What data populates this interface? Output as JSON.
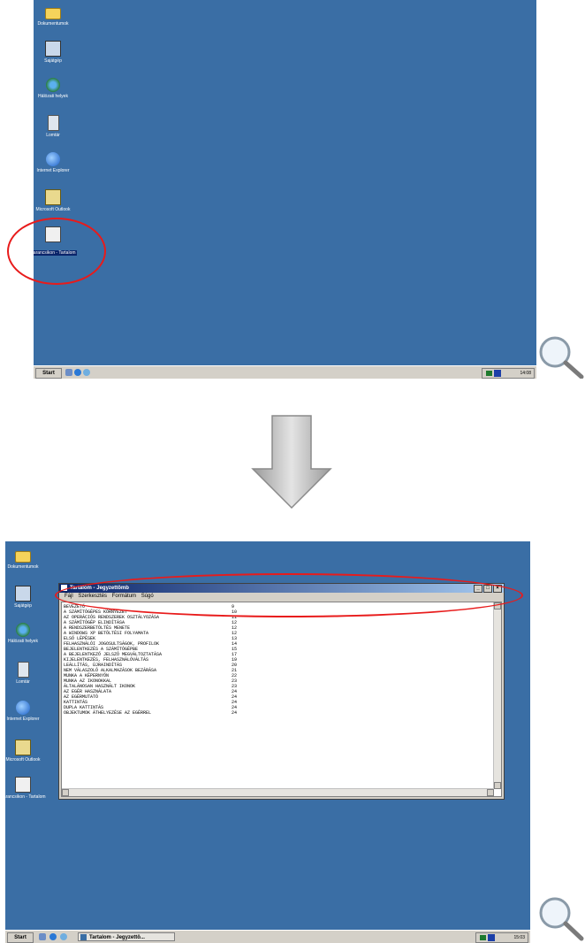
{
  "screen1": {
    "icons": [
      {
        "name": "my-documents-icon",
        "label": "Dokumentumok",
        "glyph": "g-folder"
      },
      {
        "name": "my-computer-icon",
        "label": "Sajátgép",
        "glyph": "g-pc"
      },
      {
        "name": "network-places-icon",
        "label": "Hálózati helyek",
        "glyph": "g-net"
      },
      {
        "name": "recycle-bin-icon",
        "label": "Lomtár",
        "glyph": "g-bin"
      },
      {
        "name": "internet-explorer-icon",
        "label": "Internet Explorer",
        "glyph": "g-ie"
      },
      {
        "name": "outlook-icon",
        "label": "Microsoft Outlook",
        "glyph": "g-ol"
      },
      {
        "name": "shortcut-tartalom-icon",
        "label": "Parancsikon - Tartalom",
        "glyph": "g-doc",
        "selected": true
      }
    ],
    "taskbar": {
      "start": "Start",
      "clock": "14:08"
    }
  },
  "screen2": {
    "icons": [
      {
        "name": "my-documents-icon",
        "label": "Dokumentumok",
        "glyph": "g-folder"
      },
      {
        "name": "my-computer-icon",
        "label": "Sajátgép",
        "glyph": "g-pc"
      },
      {
        "name": "network-places-icon",
        "label": "Hálózati helyek",
        "glyph": "g-net"
      },
      {
        "name": "recycle-bin-icon",
        "label": "Lomtár",
        "glyph": "g-bin"
      },
      {
        "name": "internet-explorer-icon",
        "label": "Internet Explorer",
        "glyph": "g-ie"
      },
      {
        "name": "outlook-icon",
        "label": "Microsoft Outlook",
        "glyph": "g-ol"
      },
      {
        "name": "shortcut-tartalom-icon",
        "label": "Parancsikon - Tartalom",
        "glyph": "g-doc"
      }
    ],
    "window": {
      "title": "Tartalom - Jegyzettömb",
      "menu": [
        "Fájl",
        "Szerkesztés",
        "Formátum",
        "Súgó"
      ],
      "toc": [
        {
          "t": "BEVEZETŐ",
          "p": "9"
        },
        {
          "t": "A SZÁMÍTÓGÉPES KÖRNYEZET",
          "p": "10"
        },
        {
          "t": "AZ OPERÁCIÓS RENDSZEREK OSZTÁLYOZÁSA",
          "p": "11"
        },
        {
          "t": "A SZÁMÍTÓGÉP ELINDÍTÁSA",
          "p": "12"
        },
        {
          "t": "A RENDSZERBETÖLTÉS MENETE",
          "p": "12"
        },
        {
          "t": "A WINDOWS XP BETÖLTÉSI FOLYAMATA",
          "p": "12"
        },
        {
          "t": "ELSŐ LÉPÉSEK",
          "p": "13"
        },
        {
          "t": "FELHASZNÁLÓI JOGOSULTSÁGOK, PROFILOK",
          "p": "14"
        },
        {
          "t": "BEJELENTKEZÉS A SZÁMÍTÓGÉPBE",
          "p": "15"
        },
        {
          "t": "A BEJELENTKEZŐ JELSZÓ MEGVÁLTOZTATÁSA",
          "p": "17"
        },
        {
          "t": "KIJELENTKEZÉS, FELHASZNÁLÓVÁLTÁS",
          "p": "19"
        },
        {
          "t": "LEÁLLÍTÁS, ÚJRAINDÍTÁS",
          "p": "20"
        },
        {
          "t": "NEM VÁLASZOLÓ ALKALMAZÁSOK BEZÁRÁSA",
          "p": "21"
        },
        {
          "t": "MUNKA A KÉPERNYŐN",
          "p": "22"
        },
        {
          "t": "MUNKA AZ IKONOKKAL",
          "p": "23"
        },
        {
          "t": "ÁLTALÁNOSAN HASZNÁLT IKONOK",
          "p": "23"
        },
        {
          "t": "AZ EGÉR HASZNÁLATA",
          "p": "24"
        },
        {
          "t": "AZ EGÉRMUTATÓ",
          "p": "24"
        },
        {
          "t": "KATTINTÁS",
          "p": "24"
        },
        {
          "t": "DUPLA KATTINTÁS",
          "p": "24"
        },
        {
          "t": "OBJEKTUMOK ÁTHELYEZÉSE AZ EGÉRREL",
          "p": "24"
        }
      ]
    },
    "taskbar": {
      "start": "Start",
      "task": "Tartalom - Jegyzettö...",
      "clock": "15:03"
    }
  }
}
